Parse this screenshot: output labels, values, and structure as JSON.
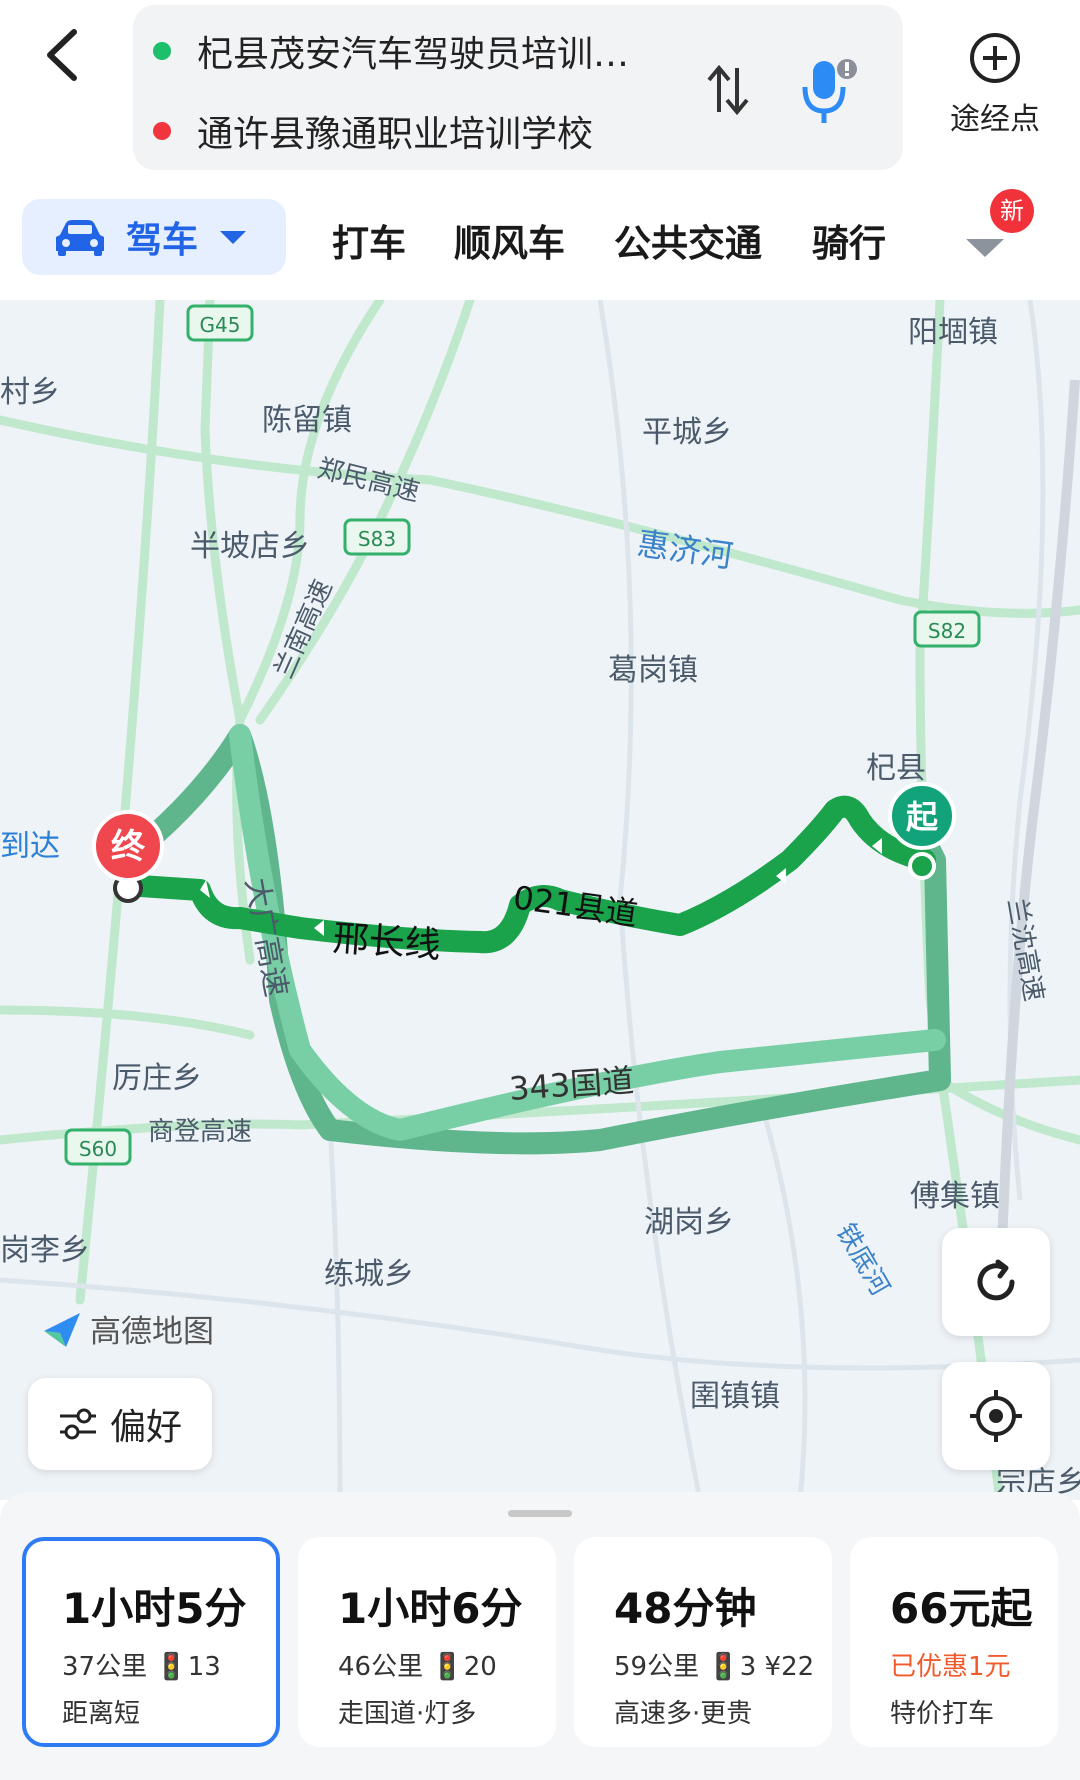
{
  "header": {
    "start": "杞县茂安汽车驾驶员培训…",
    "end": "通许县豫通职业培训学校",
    "waypoint_label": "途经点"
  },
  "tabs": {
    "active": "驾车",
    "items": [
      "打车",
      "顺风车",
      "公共交通",
      "骑行"
    ],
    "new_badge": "新"
  },
  "map": {
    "place_labels": [
      "阳堌镇",
      "村乡",
      "陈留镇",
      "平城乡",
      "半坡店乡",
      "葛岗镇",
      "杞县",
      "厉庄乡",
      "傅集镇",
      "湖岗乡",
      "练城乡",
      "圉镇镇",
      "岗李乡",
      "宗店乡",
      "到达"
    ],
    "road_labels": [
      "郑民高速",
      "惠济河",
      "兰南高速",
      "大广高速",
      "邢长线",
      "021县道",
      "343国道",
      "商登高速",
      "兰沈高速",
      "铁底河"
    ],
    "shields": [
      "G45",
      "S83",
      "S82",
      "S60"
    ],
    "start_marker": "起",
    "end_marker": "终",
    "logo": "高德地图",
    "preference_label": "偏好"
  },
  "routes": [
    {
      "time": "1小时5分",
      "distance": "37公里",
      "lights": "13",
      "tag": "距离短",
      "selected": true
    },
    {
      "time": "1小时6分",
      "distance": "46公里",
      "lights": "20",
      "tag": "走国道·灯多",
      "selected": false
    },
    {
      "time": "48分钟",
      "distance": "59公里",
      "lights": "3",
      "toll": "¥22",
      "tag": "高速多·更贵",
      "selected": false
    },
    {
      "time": "66元起",
      "discount": "已优惠1元",
      "tag": "特价打车",
      "selected": false
    }
  ],
  "colors": {
    "accent": "#2264e6",
    "route_main": "#1aa34a",
    "route_alt": "#6cc69a",
    "start_marker": "#12a37a",
    "end_marker": "#f0464e"
  }
}
